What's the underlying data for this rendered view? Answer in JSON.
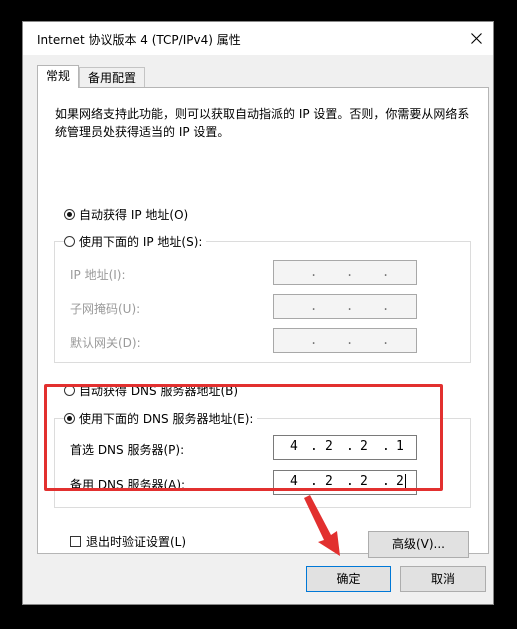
{
  "window": {
    "title": "Internet 协议版本 4 (TCP/IPv4) 属性",
    "close_icon": "close-icon"
  },
  "tabs": [
    {
      "label": "常规",
      "selected": true
    },
    {
      "label": "备用配置",
      "selected": false
    }
  ],
  "description": "如果网络支持此功能，则可以获取自动指派的 IP 设置。否则，你需要从网络系统管理员处获得适当的 IP 设置。",
  "ip_section": {
    "auto_label": "自动获得 IP 地址(O)",
    "auto_selected": true,
    "manual_label": "使用下面的 IP 地址(S):",
    "manual_selected": false,
    "fields": [
      {
        "label": "IP 地址(I):",
        "value": "",
        "enabled": false
      },
      {
        "label": "子网掩码(U):",
        "value": "",
        "enabled": false
      },
      {
        "label": "默认网关(D):",
        "value": "",
        "enabled": false
      }
    ]
  },
  "dns_section": {
    "auto_label": "自动获得 DNS 服务器地址(B)",
    "auto_selected": false,
    "manual_label": "使用下面的 DNS 服务器地址(E):",
    "manual_selected": true,
    "preferred": {
      "label": "首选 DNS 服务器(P):",
      "octets": [
        "4",
        "2",
        "2",
        "1"
      ]
    },
    "alternate": {
      "label": "备用 DNS 服务器(A):",
      "octets": [
        "4",
        "2",
        "2",
        "2"
      ]
    }
  },
  "validate_on_exit": {
    "label": "退出时验证设置(L)",
    "checked": false
  },
  "buttons": {
    "advanced": "高级(V)...",
    "ok": "确定",
    "cancel": "取消"
  },
  "colors": {
    "highlight": "#e2302f",
    "default_button_border": "#0078d7"
  }
}
